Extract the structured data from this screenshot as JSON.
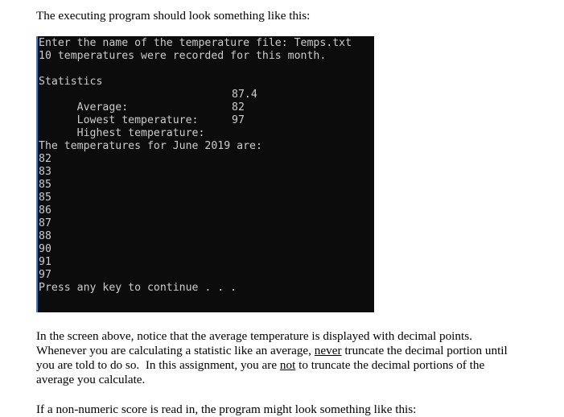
{
  "document": {
    "intro": "The executing program should look something like this:",
    "notice_paragraph": {
      "line1": "In the screen above, notice that the average temperature is displayed with decimal points.",
      "line2_pre": "Whenever you are calculating a statistic like an average, ",
      "line2_emph": "never",
      "line2_post": " truncate the decimal portion until",
      "line3_pre": "you are told to do so.  In this assignment, you are ",
      "line3_emph": "not",
      "line3_post": " to truncate the decimal portions of the",
      "line4": "average you calculate."
    },
    "nonnumeric_paragraph": "If a non-numeric score is read in, the program might look something like this:"
  },
  "console": {
    "prompt_line": "Enter the name of the temperature file: Temps.txt",
    "count_line": "10 temperatures were recorded for this month.",
    "statistics_header": "Statistics",
    "stats": [
      {
        "label": "Average:",
        "value": "87.4"
      },
      {
        "label": "Lowest temperature:",
        "value": "82"
      },
      {
        "label": "Highest temperature:",
        "value": "97"
      }
    ],
    "list_header": "The temperatures for June 2019 are:",
    "temperatures": [
      "82",
      "83",
      "85",
      "85",
      "86",
      "87",
      "88",
      "90",
      "91",
      "97"
    ],
    "continue_prompt": "Press any key to continue . . ."
  },
  "colors": {
    "console_background": "#0c0c0c",
    "console_text": "#cccccc",
    "console_left_border": "#3a7bd5"
  }
}
